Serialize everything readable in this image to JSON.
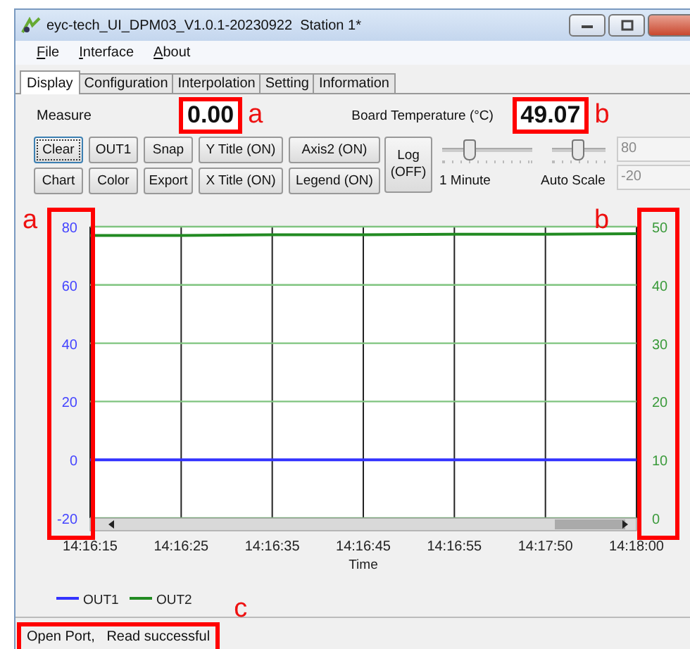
{
  "window": {
    "title": "eyc-tech_UI_DPM03_V1.0.1-20230922  Station 1*"
  },
  "menu": [
    {
      "label": "File"
    },
    {
      "label": "Interface"
    },
    {
      "label": "About"
    }
  ],
  "tabs": [
    {
      "label": "Display",
      "selected": true
    },
    {
      "label": "Configuration",
      "selected": false
    },
    {
      "label": "Interpolation",
      "selected": false
    },
    {
      "label": "Setting",
      "selected": false
    },
    {
      "label": "Information",
      "selected": false
    }
  ],
  "measure": {
    "label": "Measure",
    "value": "0.00",
    "annotation": "a"
  },
  "board_temperature": {
    "label": "Board Temperature (°C)",
    "value": "49.07",
    "annotation": "b"
  },
  "buttons": [
    {
      "label": "Clear",
      "kind": "small",
      "focused": true
    },
    {
      "label": "OUT1",
      "kind": "small",
      "focused": false
    },
    {
      "label": "Snap",
      "kind": "small",
      "focused": false
    },
    {
      "label": "Y Title (ON)",
      "kind": "wide",
      "focused": false
    },
    {
      "label": "Axis2 (ON)",
      "kind": "wider",
      "focused": false
    },
    {
      "label": "Log (OFF)",
      "kind": "tall",
      "focused": false
    },
    {
      "label": "Chart",
      "kind": "small",
      "focused": false
    },
    {
      "label": "Color",
      "kind": "small",
      "focused": false
    },
    {
      "label": "Export",
      "kind": "small",
      "focused": false
    },
    {
      "label": "X Title (ON)",
      "kind": "wide",
      "focused": false
    },
    {
      "label": "Legend (ON)",
      "kind": "wider",
      "focused": false
    }
  ],
  "sliders": [
    {
      "label": "1 Minute",
      "level": 0.3
    },
    {
      "label": "Auto Scale",
      "level": 0.45
    }
  ],
  "spinners": [
    {
      "value": "80",
      "disabled": true
    },
    {
      "value": "-20",
      "disabled": true
    }
  ],
  "chart": {
    "left_annotation": "a",
    "right_annotation": "b",
    "chart_data": {
      "type": "line",
      "xlabel": "Time",
      "categories": [
        "14:16:15",
        "14:16:25",
        "14:16:35",
        "14:16:45",
        "14:16:55",
        "14:17:50",
        "14:18:00"
      ],
      "series": [
        {
          "name": "OUT1",
          "color": "#3333ff",
          "values": [
            0,
            0,
            0,
            0,
            0,
            0,
            0
          ]
        },
        {
          "name": "OUT2",
          "color": "#228b22",
          "axis": "y2",
          "values": [
            48.5,
            48.5,
            48.6,
            48.6,
            48.7,
            48.7,
            48.8
          ]
        }
      ],
      "ylim": [
        -20,
        80
      ],
      "yticks": [
        -20,
        0,
        20,
        40,
        60,
        80
      ],
      "y2lim": [
        0,
        50
      ],
      "y2ticks": [
        0,
        10,
        20,
        30,
        40,
        50
      ],
      "grid": true,
      "legend": true
    }
  },
  "status_bar": {
    "text": "Open Port,   Read successful",
    "annotation": "c"
  }
}
